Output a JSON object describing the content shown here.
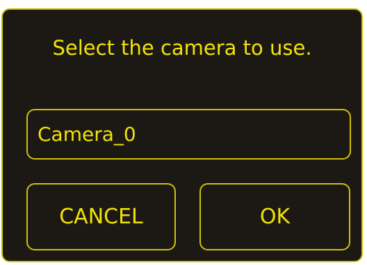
{
  "dialog": {
    "prompt": "Select the camera to use.",
    "camera_field": {
      "value": "Camera_0"
    },
    "buttons": {
      "cancel_label": "CANCEL",
      "ok_label": "OK"
    }
  },
  "colors": {
    "background": "#1c1914",
    "accent": "#cfc20a",
    "text": "#f2e20a"
  }
}
